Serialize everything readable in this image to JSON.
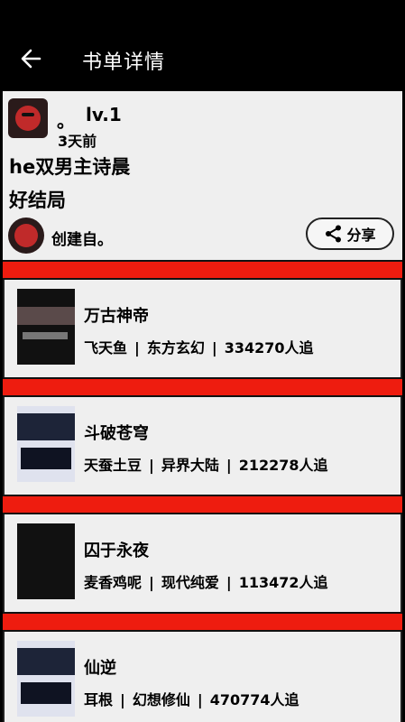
{
  "header": {
    "title": "书单详情",
    "back_icon": "arrow-left-icon"
  },
  "author": {
    "name": "。",
    "level": "lv.1",
    "time": "3天前"
  },
  "list": {
    "name": "he双男主诗晨",
    "description": "好结局",
    "creator_label": "创建自。"
  },
  "share": {
    "label": "分享",
    "icon": "share-icon"
  },
  "books": [
    {
      "title": "万古神帝",
      "author": "飞天鱼",
      "category": "东方玄幻",
      "followers": "334270人追"
    },
    {
      "title": "斗破苍穹",
      "author": "天蚕土豆",
      "category": "异界大陆",
      "followers": "212278人追"
    },
    {
      "title": "囚于永夜",
      "author": "麦香鸡呢",
      "category": "现代纯爱",
      "followers": "113472人追"
    },
    {
      "title": "仙逆",
      "author": "耳根",
      "category": "幻想修仙",
      "followers": "470774人追"
    }
  ],
  "colors": {
    "accent_red": "#ee1c0f",
    "topbar": "#000000",
    "background": "#efefef"
  }
}
